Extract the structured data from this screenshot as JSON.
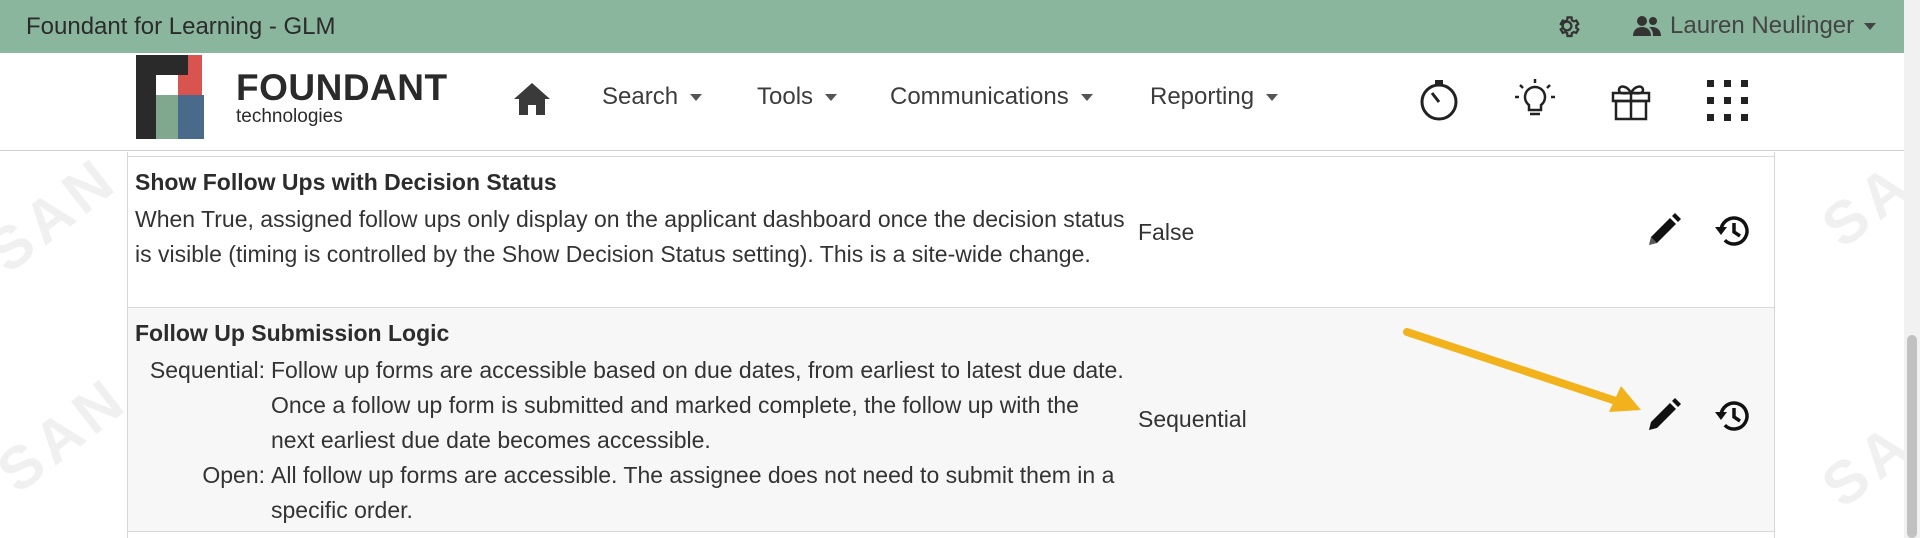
{
  "app": {
    "title": "Foundant for Learning - GLM",
    "user_name": "Lauren Neulinger"
  },
  "logo": {
    "main": "FOUNDANT",
    "sub": "technologies"
  },
  "nav": {
    "items": [
      {
        "label": "Search"
      },
      {
        "label": "Tools"
      },
      {
        "label": "Communications"
      },
      {
        "label": "Reporting"
      }
    ]
  },
  "settings": [
    {
      "title": "Show Follow Ups with Decision Status",
      "description": "When True, assigned follow ups only display on the applicant dashboard once the decision status is visible (timing is controlled by the Show Decision Status setting). This is a site-wide change.",
      "value": "False"
    },
    {
      "title": "Follow Up Submission Logic",
      "definitions": [
        {
          "term": "Sequential:",
          "text": "Follow up forms are accessible based on due dates, from earliest to latest due date. Once a follow up form is submitted and marked complete, the follow up with the next earliest due date becomes accessible."
        },
        {
          "term": "Open:",
          "text": "All follow up forms are accessible. The assignee does not need to submit them in a specific order."
        }
      ],
      "value": "Sequential"
    }
  ],
  "watermark": "SANDBOX",
  "colors": {
    "topbar": "#8ab69d",
    "arrow": "#f2b21b",
    "logo_green": "#7fa88e",
    "logo_red": "#d9534f",
    "logo_blue": "#4a6a8c"
  },
  "icons": [
    "gear-icon",
    "users-icon",
    "home-icon",
    "stopwatch-icon",
    "lightbulb-icon",
    "gift-icon",
    "apps-grid-icon",
    "pencil-icon",
    "history-icon"
  ]
}
